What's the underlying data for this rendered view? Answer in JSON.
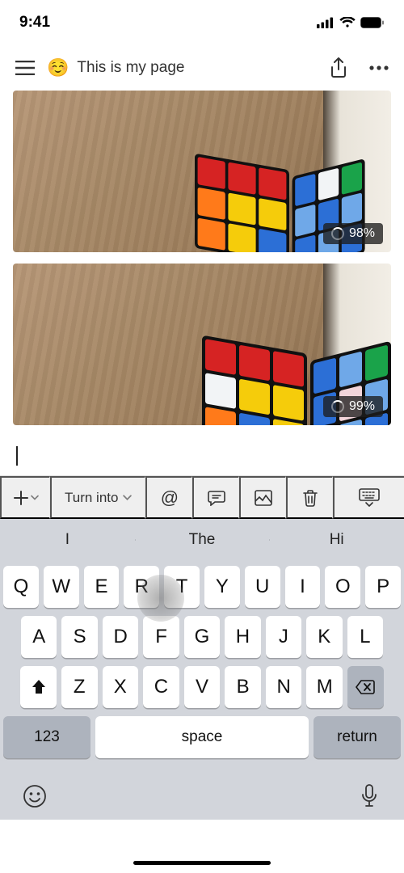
{
  "status": {
    "time": "9:41"
  },
  "header": {
    "emoji": "☺️",
    "title": "This is my page"
  },
  "images": [
    {
      "progress": "98%"
    },
    {
      "progress": "99%"
    }
  ],
  "toolbar": {
    "turn_into_label": "Turn into",
    "mention_symbol": "@"
  },
  "suggestions": [
    "I",
    "The",
    "Hi"
  ],
  "keyboard": {
    "row1": [
      "Q",
      "W",
      "E",
      "R",
      "T",
      "Y",
      "U",
      "I",
      "O",
      "P"
    ],
    "row2": [
      "A",
      "S",
      "D",
      "F",
      "G",
      "H",
      "J",
      "K",
      "L"
    ],
    "row3": [
      "Z",
      "X",
      "C",
      "V",
      "B",
      "N",
      "M"
    ],
    "numeric_label": "123",
    "space_label": "space",
    "return_label": "return"
  }
}
